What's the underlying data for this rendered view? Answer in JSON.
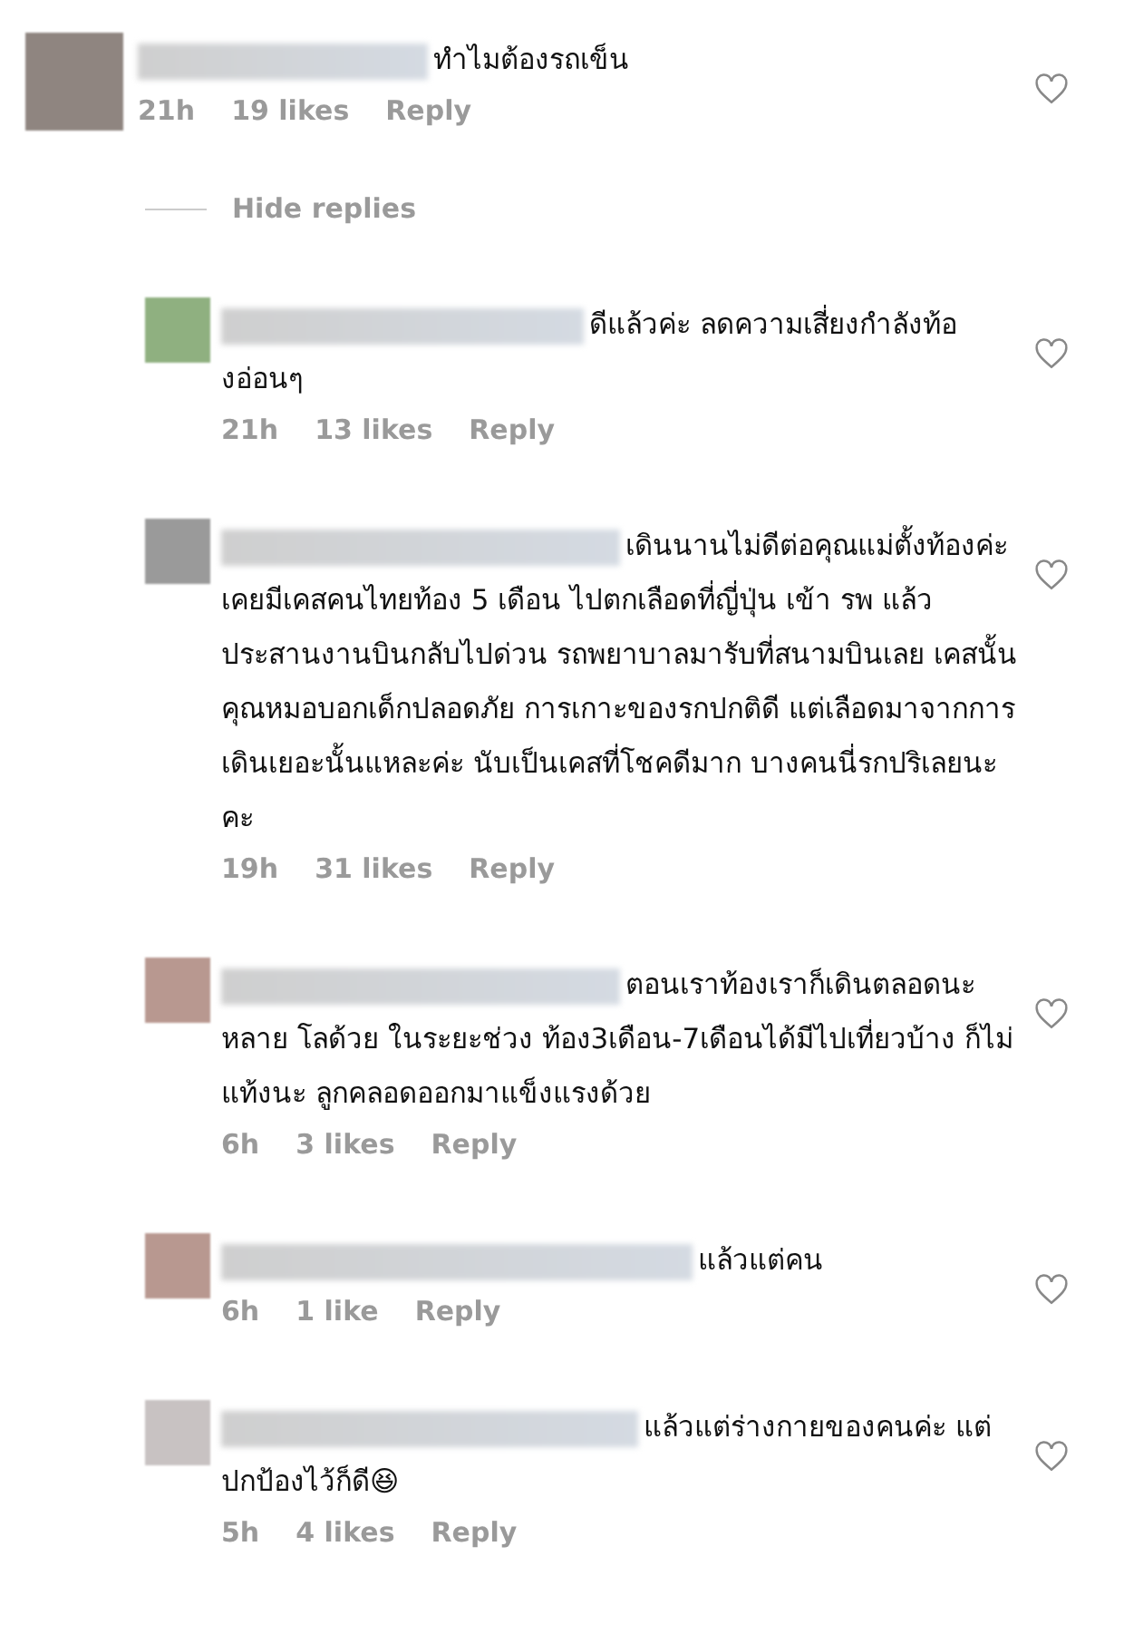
{
  "comment": {
    "color": "#8f8580",
    "text": "ทำไมต้องรถเข็น",
    "time": "21h",
    "likes": "19 likes",
    "reply": "Reply",
    "hide_replies": "Hide replies",
    "replies": [
      {
        "color": "#8fb080",
        "text": "ดีแล้วค่ะ ลดความเสี่ยงกำลังท้องอ่อนๆ",
        "time": "21h",
        "likes": "13 likes",
        "reply": "Reply"
      },
      {
        "color": "#9a9a9a",
        "text": "เดินนานไม่ดีต่อคุณแม่ตั้งท้องค่ะ  เคยมีเคสคนไทยท้อง 5 เดือน ไปตกเลือดที่ญี่ปุ่น เข้า รพ แล้วประสานงานบินกลับไปด่วน รถพยาบาลมารับที่สนามบินเลย เคสนั้นคุณหมอบอกเด็กปลอดภัย การเกาะของรกปกติดี แต่เลือดมาจากการเดินเยอะนั้นแหละค่ะ นับเป็นเคสที่โชคดีมาก บางคนนี่รกปริเลยนะคะ",
        "time": "19h",
        "likes": "31 likes",
        "reply": "Reply"
      },
      {
        "color": "#b89890",
        "text": "ตอนเราท้องเราก็เดินตลอดนะ หลาย โลด้วย ในระยะช่วง ท้อง3เดือน-7เดือนได้มีไปเที่ยวบ้าง ก็ไม่แท้งนะ ลูกคลอดออกมาแข็งแรงด้วย",
        "time": "6h",
        "likes": "3 likes",
        "reply": "Reply"
      },
      {
        "color": "#b89890",
        "text": "แล้วแต่คน",
        "time": "6h",
        "likes": "1 like",
        "reply": "Reply"
      },
      {
        "color": "#c8c2c2",
        "text": "แล้วแต่ร่างกายของคนค่ะ แต่ปกป้องไว้ก็ดี😆",
        "time": "5h",
        "likes": "4 likes",
        "reply": "Reply"
      }
    ]
  }
}
